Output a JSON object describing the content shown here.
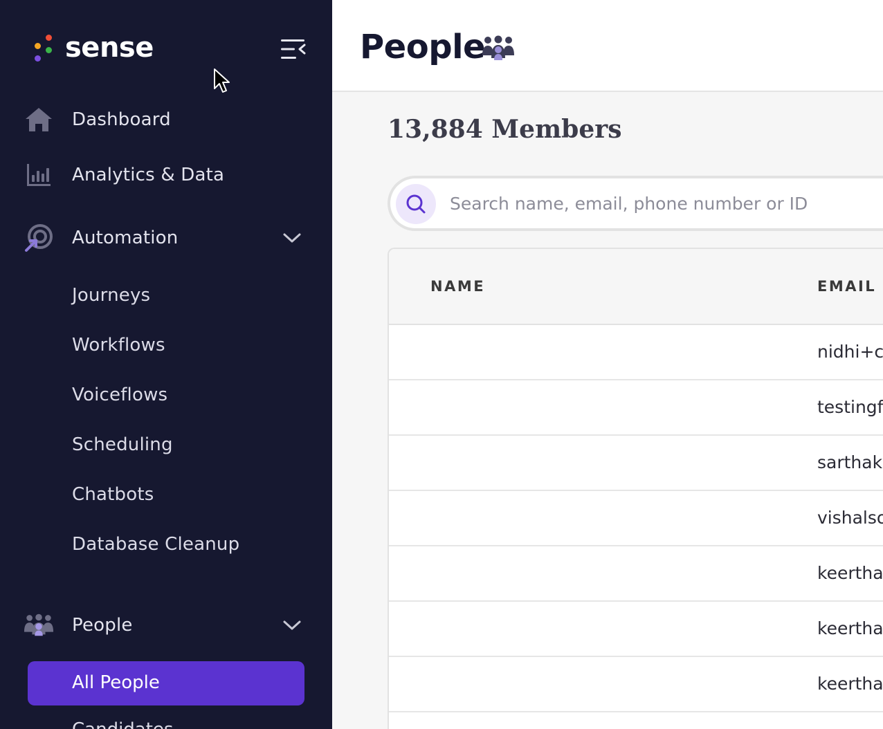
{
  "brand": {
    "name": "sense",
    "dot_colors": [
      "#f04e37",
      "#f5a623",
      "#3bb54a",
      "#7b4fe0"
    ]
  },
  "sidebar": {
    "collapse_icon": "collapse-menu-icon",
    "items": [
      {
        "label": "Dashboard",
        "icon": "home-icon"
      },
      {
        "label": "Analytics & Data",
        "icon": "bar-chart-icon"
      },
      {
        "label": "Automation",
        "icon": "automation-target-icon",
        "expanded": true
      }
    ],
    "automation_sub": [
      "Journeys",
      "Workflows",
      "Voiceflows",
      "Scheduling",
      "Chatbots",
      "Database Cleanup"
    ],
    "people": {
      "label": "People",
      "icon": "people-group-icon",
      "expanded": true
    },
    "people_sub_active": "All People",
    "people_sub_next": "Candidates"
  },
  "header": {
    "title": "People",
    "title_icon": "people-group-icon"
  },
  "main": {
    "member_count": "13,884 Members",
    "search": {
      "placeholder": "Search name, email, phone number or ID",
      "value": ""
    },
    "table": {
      "columns": [
        "NAME",
        "EMAIL"
      ],
      "rows": [
        {
          "name": "",
          "email": "nidhi+ca"
        },
        {
          "name": "",
          "email": "testingf"
        },
        {
          "name": "",
          "email": "sarthak."
        },
        {
          "name": "",
          "email": "vishalso"
        },
        {
          "name": "",
          "email": "keertha"
        },
        {
          "name": "",
          "email": "keertha"
        },
        {
          "name": "",
          "email": "keertha"
        }
      ]
    }
  },
  "colors": {
    "sidebar_bg": "#161830",
    "accent": "#5b33d0",
    "icon_muted": "#6e6e86"
  }
}
